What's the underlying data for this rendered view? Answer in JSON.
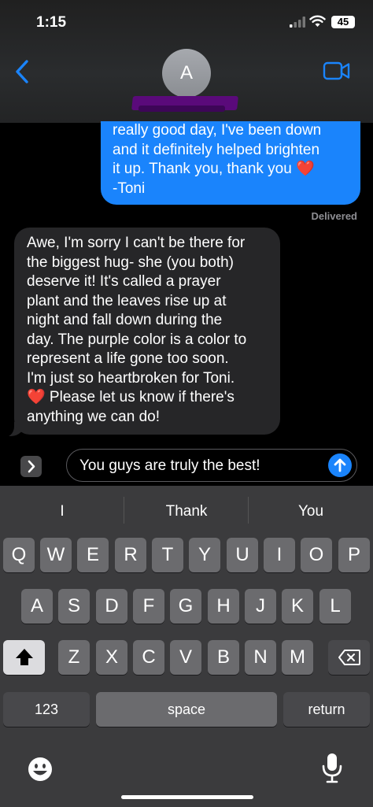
{
  "status": {
    "time": "1:15",
    "battery": "45"
  },
  "contact": {
    "initial": "A"
  },
  "messages": {
    "outgoing_lines": [
      "really good day, I've been down",
      "and it definitely helped brighten",
      "it up. Thank you, thank you ❤️",
      "-Toni"
    ],
    "delivered": "Delivered",
    "incoming_lines": [
      "Awe, I'm sorry I can't be there for",
      "the biggest hug- she (you both)",
      "deserve it! It's called a prayer",
      "plant and the leaves rise up at",
      "night and fall down during the",
      "day. The purple color is a color to",
      "represent a life gone too soon.",
      "I'm just so heartbroken for Toni.",
      "❤️ Please let us know if there's",
      "anything we can do!"
    ]
  },
  "input": {
    "value": "You guys are truly the best!"
  },
  "suggestions": [
    "I",
    "Thank",
    "You"
  ],
  "keyboard": {
    "row1": [
      "Q",
      "W",
      "E",
      "R",
      "T",
      "Y",
      "U",
      "I",
      "O",
      "P"
    ],
    "row2": [
      "A",
      "S",
      "D",
      "F",
      "G",
      "H",
      "J",
      "K",
      "L"
    ],
    "row3": [
      "Z",
      "X",
      "C",
      "V",
      "B",
      "N",
      "M"
    ],
    "numbers": "123",
    "space": "space",
    "return": "return"
  },
  "colors": {
    "accent": "#1a84fc",
    "incoming_bubble": "#262628",
    "keyboard_bg": "#3b3b3d"
  }
}
